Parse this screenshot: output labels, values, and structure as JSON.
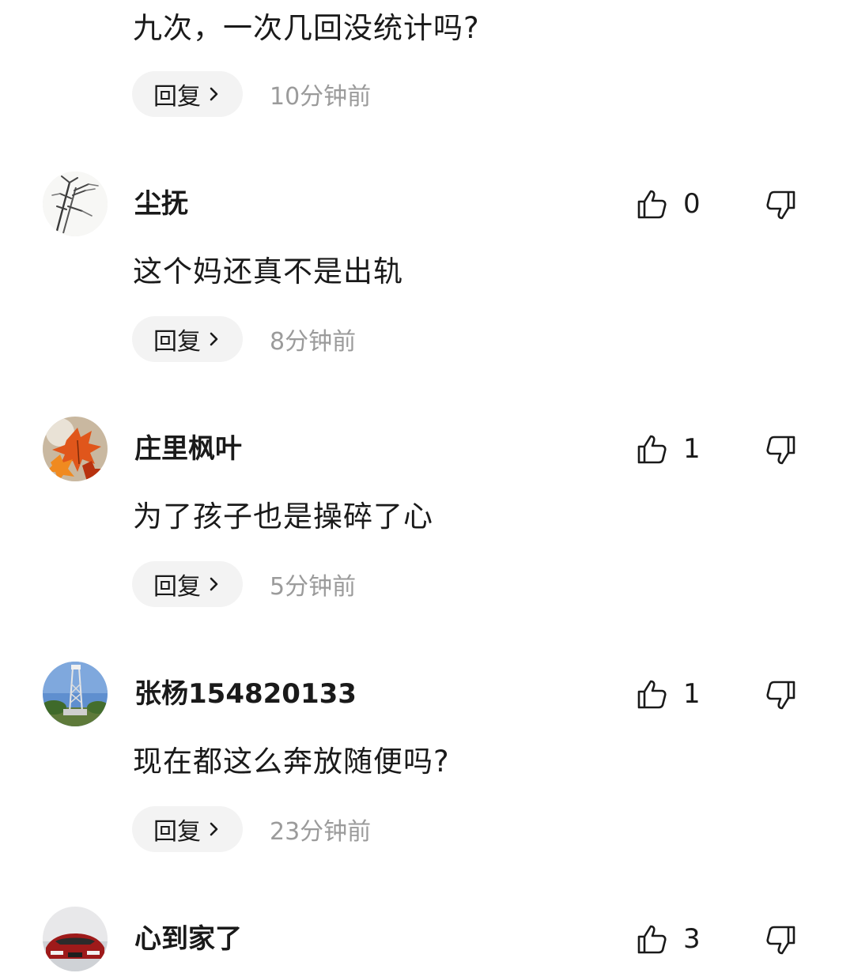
{
  "top_partial": {
    "content": "九次，一次几回没统计吗?",
    "reply_label": "回复",
    "time": "10分钟前"
  },
  "comments": [
    {
      "username": "尘抚",
      "likes": "0",
      "content": "这个妈还真不是出轨",
      "reply_label": "回复",
      "time": "8分钟前",
      "avatar": "bamboo-ink-painting"
    },
    {
      "username": "庄里枫叶",
      "likes": "1",
      "content": "为了孩子也是操碎了心",
      "reply_label": "回复",
      "time": "5分钟前",
      "avatar": "autumn-maple-leaves"
    },
    {
      "username": "张杨154820133",
      "likes": "1",
      "content": "现在都这么奔放随便吗?",
      "reply_label": "回复",
      "time": "23分钟前",
      "avatar": "tower-landscape"
    },
    {
      "username": "心到家了",
      "likes": "3",
      "avatar": "red-sports-car"
    }
  ],
  "icons": {
    "like": "thumbs-up-icon",
    "dislike": "thumbs-down-icon",
    "reply_chevron": "chevron-right-icon"
  },
  "colors": {
    "text": "#1a1a1a",
    "muted": "#9b9b9b",
    "reply_bg": "#f3f3f3"
  }
}
